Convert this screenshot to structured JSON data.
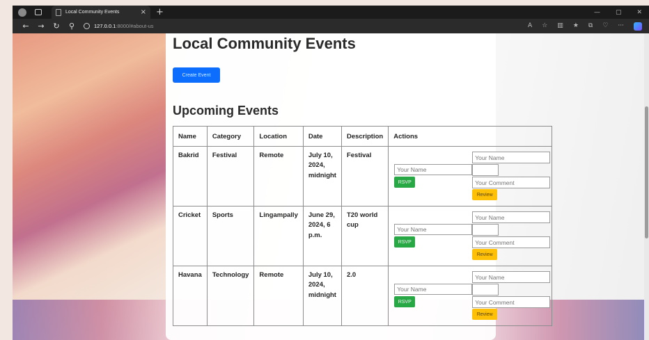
{
  "browser": {
    "tab_title": "Local Community Events",
    "tab_close": "×",
    "new_tab": "+",
    "url_host": "127.0.0.1",
    "url_path": ":8000/#about-us",
    "win_min": "—",
    "win_max": "▢",
    "win_close": "✕",
    "nav_back": "←",
    "nav_forward": "→",
    "nav_reload": "↻",
    "nav_search": "⚲",
    "tb_read": "A",
    "tb_fav": "☆",
    "tb_split": "▥",
    "tb_favorites": "★",
    "tb_collections": "⧉",
    "tb_ext": "♡",
    "tb_more": "···"
  },
  "page": {
    "title": "Local Community Events",
    "create_button": "Create Event",
    "section_title": "Upcoming Events"
  },
  "table": {
    "headers": [
      "Name",
      "Category",
      "Location",
      "Date",
      "Description",
      "Actions"
    ],
    "rows": [
      {
        "name": "Bakrid",
        "category": "Festival",
        "location": "Remote",
        "date": "July 10, 2024, midnight",
        "description": "Festival"
      },
      {
        "name": "Cricket",
        "category": "Sports",
        "location": "Lingampally",
        "date": "June 29, 2024, 6 p.m.",
        "description": "T20 world cup"
      },
      {
        "name": "Havana",
        "category": "Technology",
        "location": "Remote",
        "date": "July 10, 2024, midnight",
        "description": "2.0"
      }
    ]
  },
  "actions": {
    "rsvp_name_placeholder": "Your Name",
    "rsvp_button": "RSVP",
    "review_name_placeholder": "Your Name",
    "review_comment_placeholder": "Your Comment",
    "review_button": "Review"
  },
  "colors": {
    "primary": "#0d6efd",
    "success": "#28a745",
    "warning": "#ffc107"
  }
}
